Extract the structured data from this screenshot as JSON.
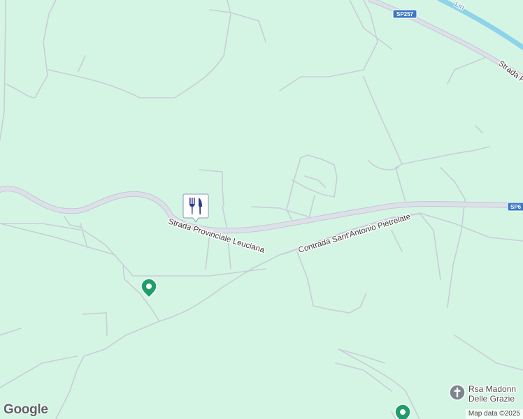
{
  "map": {
    "background_color": "#d4f5e4",
    "road_color": "#d8dce6",
    "road_outline_color": "#c3c8d4",
    "minor_road_color": "#c9ced8",
    "water_color": "#8fd3ea",
    "roads": {
      "main_label": "Strada Provinciale Leuciana",
      "secondary_label": "Contrada Sant'Antonio Pietrelate",
      "upper_right_label": "Strada P"
    },
    "shields": {
      "sp257": "SP257",
      "sp6": "SP6"
    },
    "river_label": "Liri",
    "pois": {
      "restaurant_icon": "restaurant-icon",
      "church_label_line1": "Rsa Madonn",
      "church_label_line2": "Delle Grazie",
      "church_icon": "cross-icon",
      "place_icon": "place-pin-icon"
    }
  },
  "branding": {
    "logo": "Google",
    "attribution": "Map data ©2025"
  }
}
